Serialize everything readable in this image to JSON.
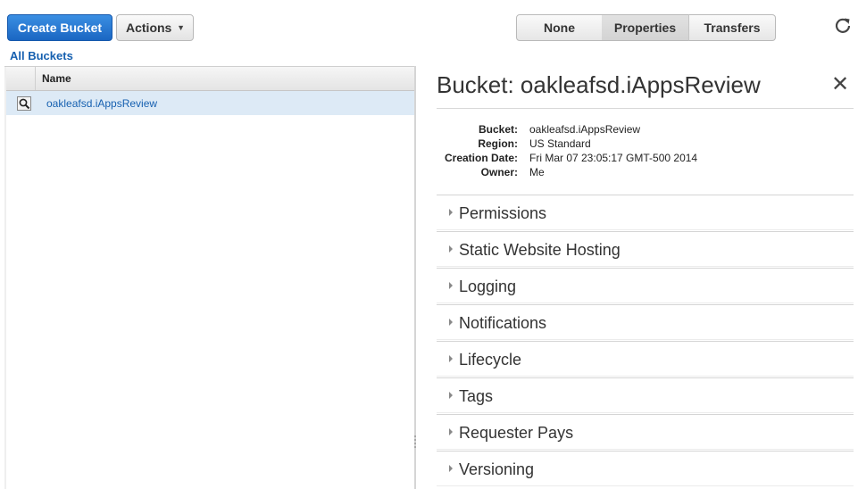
{
  "toolbar": {
    "create_bucket": "Create Bucket",
    "actions": "Actions",
    "view_none": "None",
    "view_properties": "Properties",
    "view_transfers": "Transfers",
    "refresh_icon": "refresh-icon"
  },
  "left": {
    "all_buckets": "All Buckets",
    "column_name": "Name",
    "buckets": [
      {
        "name": "oakleafsd.iAppsReview",
        "icon": "magnifier-icon",
        "selected": true
      }
    ]
  },
  "detail": {
    "title": "Bucket: oakleafsd.iAppsReview",
    "close_icon": "close-icon",
    "properties": [
      {
        "label": "Bucket:",
        "value": "oakleafsd.iAppsReview"
      },
      {
        "label": "Region:",
        "value": "US Standard"
      },
      {
        "label": "Creation Date:",
        "value": "Fri Mar 07 23:05:17 GMT-500 2014"
      },
      {
        "label": "Owner:",
        "value": "Me"
      }
    ],
    "sections": [
      {
        "label": "Permissions"
      },
      {
        "label": "Static Website Hosting"
      },
      {
        "label": "Logging"
      },
      {
        "label": "Notifications"
      },
      {
        "label": "Lifecycle"
      },
      {
        "label": "Tags"
      },
      {
        "label": "Requester Pays"
      },
      {
        "label": "Versioning"
      }
    ]
  },
  "colors": {
    "primary_button": "#1a66c2",
    "link": "#1660b0",
    "selected_row": "#ddeaf6"
  }
}
